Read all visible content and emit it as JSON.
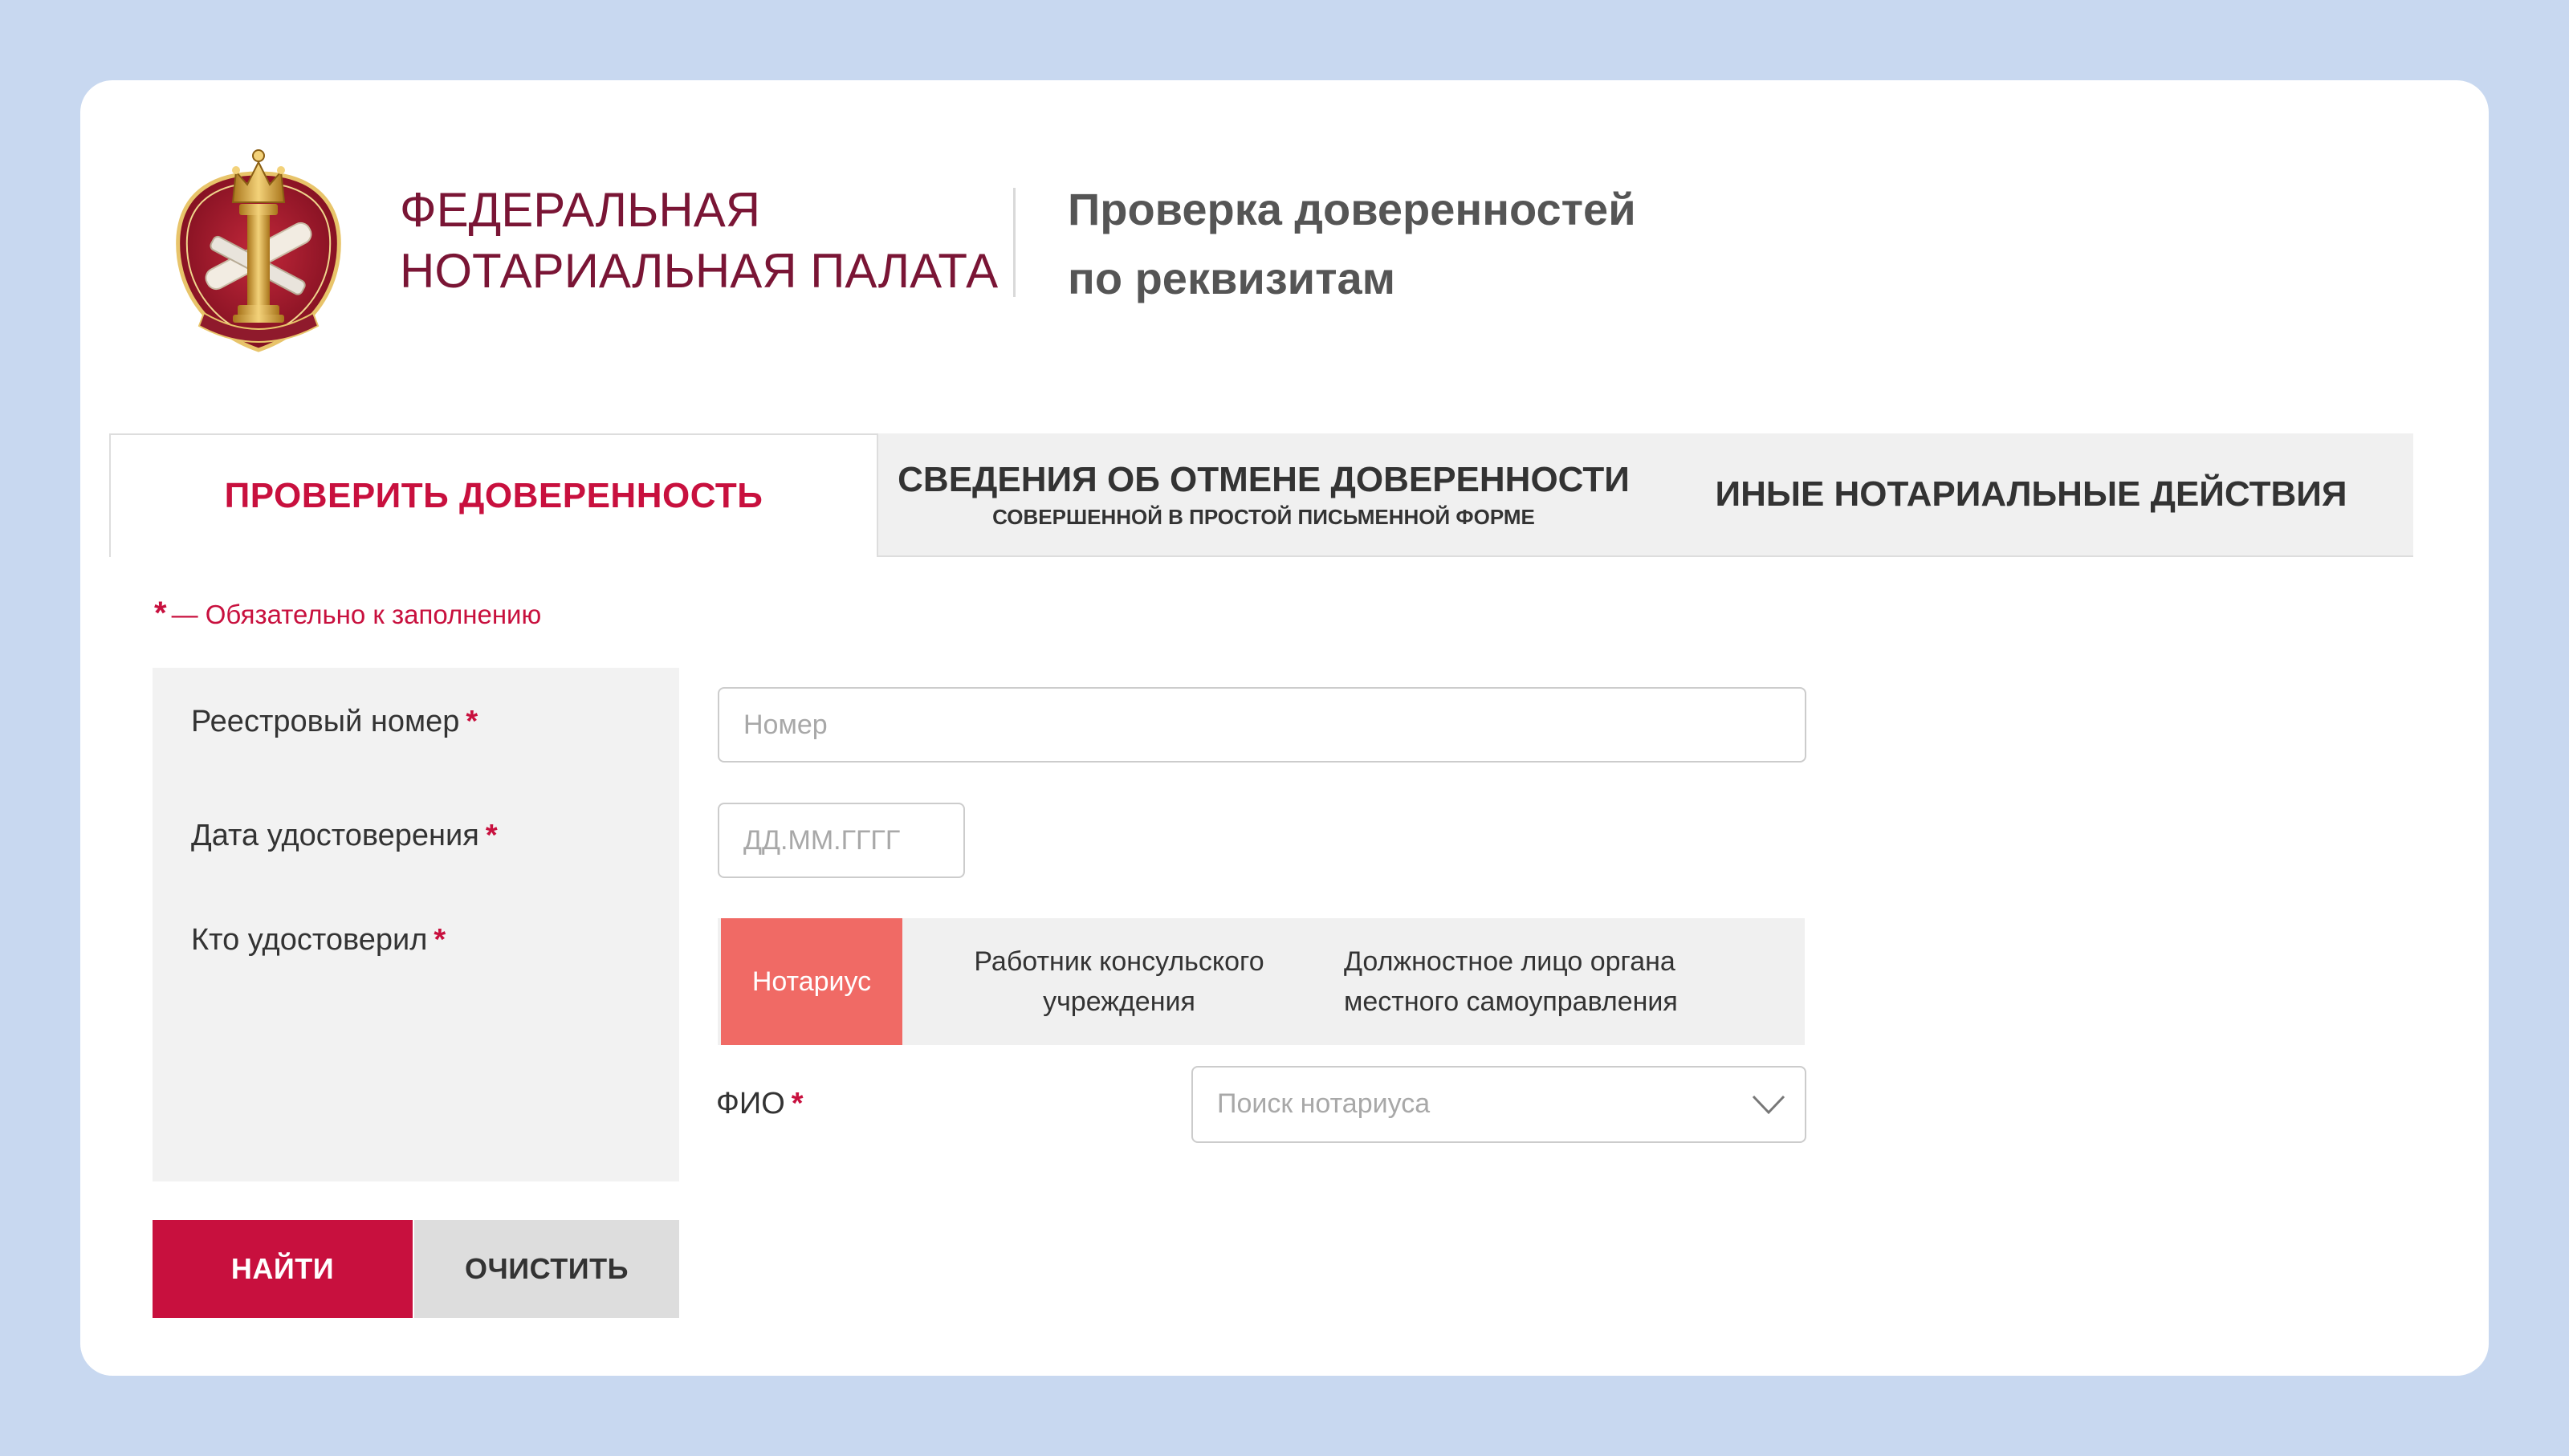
{
  "header": {
    "org_name_line1": "Федеральная",
    "org_name_line2": "нотариальная палата",
    "service_title_line1": "Проверка доверенностей",
    "service_title_line2": "по реквизитам",
    "logo_icon": "notary-chamber-emblem-icon"
  },
  "tabs": [
    {
      "label": "ПРОВЕРИТЬ ДОВЕРЕННОСТЬ",
      "sublabel": "",
      "active": true
    },
    {
      "label": "СВЕДЕНИЯ ОБ ОТМЕНЕ ДОВЕРЕННОСТИ",
      "sublabel": "СОВЕРШЕННОЙ В ПРОСТОЙ ПИСЬМЕННОЙ ФОРМЕ",
      "active": false
    },
    {
      "label": "ИНЫЕ НОТАРИАЛЬНЫЕ ДЕЙСТВИЯ",
      "sublabel": "",
      "active": false
    }
  ],
  "form": {
    "required_star": "*",
    "required_note": "— Обязательно к заполнению",
    "registry_number": {
      "label": "Реестровый номер",
      "value": "",
      "placeholder": "Номер"
    },
    "certification_date": {
      "label": "Дата удостоверения",
      "value": "",
      "placeholder": "ДД.ММ.ГГГГ"
    },
    "certified_by": {
      "label": "Кто удостоверил",
      "options": [
        {
          "line1": "Нотариус",
          "line2": "",
          "selected": true
        },
        {
          "line1": "Работник консульского",
          "line2": "учреждения",
          "selected": false
        },
        {
          "line1": "Должностное лицо органа",
          "line2": "местного самоуправления",
          "selected": false
        }
      ]
    },
    "fio": {
      "label": "ФИО",
      "placeholder": "Поиск нотариуса",
      "icon": "chevron-down-icon"
    }
  },
  "buttons": {
    "find_label": "НАЙТИ",
    "clear_label": "ОЧИСТИТЬ"
  },
  "colors": {
    "accent": "#c8103e",
    "brand_dark": "#7a1535",
    "selected_option": "#f06a65",
    "page_background": "#c8d8f0"
  }
}
